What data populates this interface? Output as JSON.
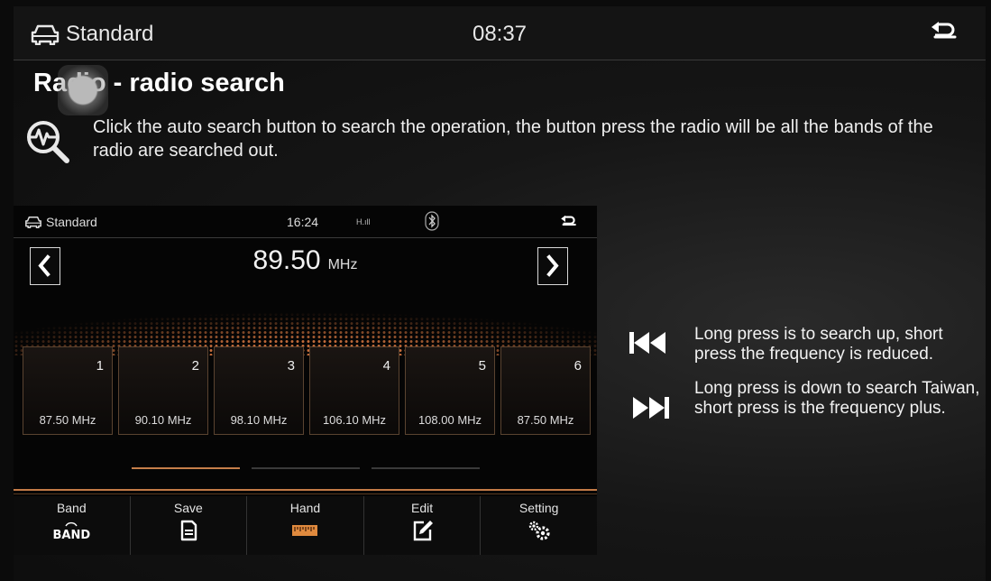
{
  "topbar": {
    "mode_label": "Standard",
    "time": "08:37"
  },
  "page": {
    "title": "Radio - radio search",
    "description": "Click the auto search button to search the operation, the button press the radio will be all the bands of the radio are searched out."
  },
  "radio_screen": {
    "mode_label": "Standard",
    "time": "16:24",
    "signal": "H.ıll",
    "frequency": "89.50",
    "unit": "MHz",
    "presets": [
      {
        "number": "1",
        "freq": "87.50 MHz"
      },
      {
        "number": "2",
        "freq": "90.10 MHz"
      },
      {
        "number": "3",
        "freq": "98.10 MHz"
      },
      {
        "number": "4",
        "freq": "106.10 MHz"
      },
      {
        "number": "5",
        "freq": "108.00 MHz"
      },
      {
        "number": "6",
        "freq": "87.50 MHz"
      }
    ],
    "toolbar": {
      "band": "Band",
      "band_icon_text": "BAND",
      "save": "Save",
      "hand": "Hand",
      "edit": "Edit",
      "setting": "Setting"
    }
  },
  "explanations": {
    "prev": "Long press is to search up, short press the frequency is reduced.",
    "next": "Long press is down to search Taiwan, short press is the frequency plus."
  },
  "colors": {
    "accent": "#d98a4e",
    "background": "#0b0b0b"
  }
}
